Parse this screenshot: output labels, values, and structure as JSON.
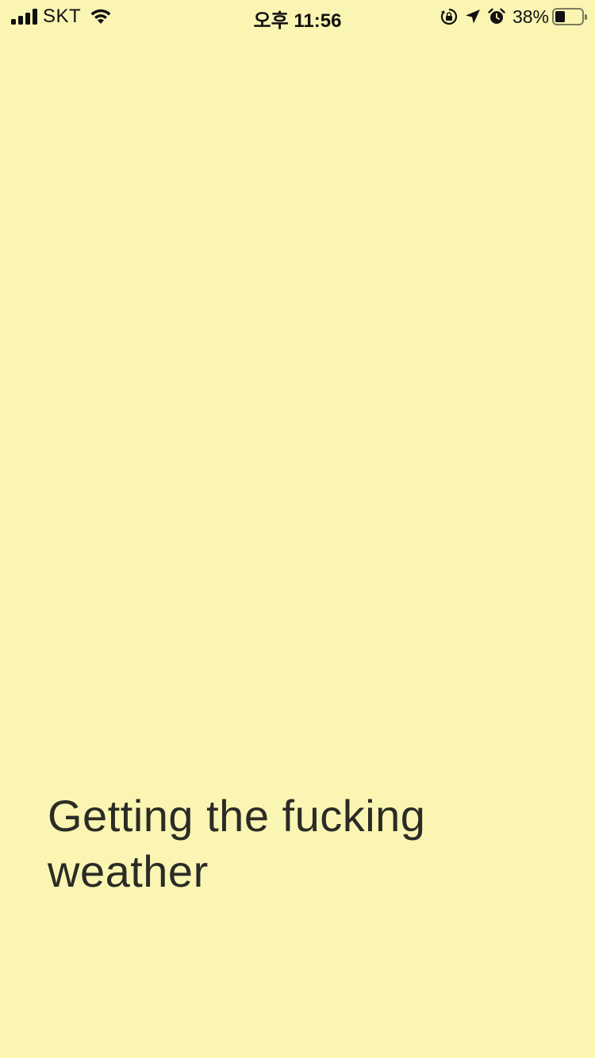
{
  "status_bar": {
    "carrier": "SKT",
    "time": "오후 11:56",
    "battery_percent_text": "38%",
    "battery_level": 0.38,
    "signal_bars": 4,
    "icons": [
      "signal-icon",
      "wifi-icon",
      "orientation-lock-icon",
      "location-arrow-icon",
      "alarm-icon",
      "battery-icon"
    ]
  },
  "main": {
    "message": "Getting the fucking weather"
  },
  "colors": {
    "background": "#faf5b2",
    "text": "#2b2b26"
  }
}
